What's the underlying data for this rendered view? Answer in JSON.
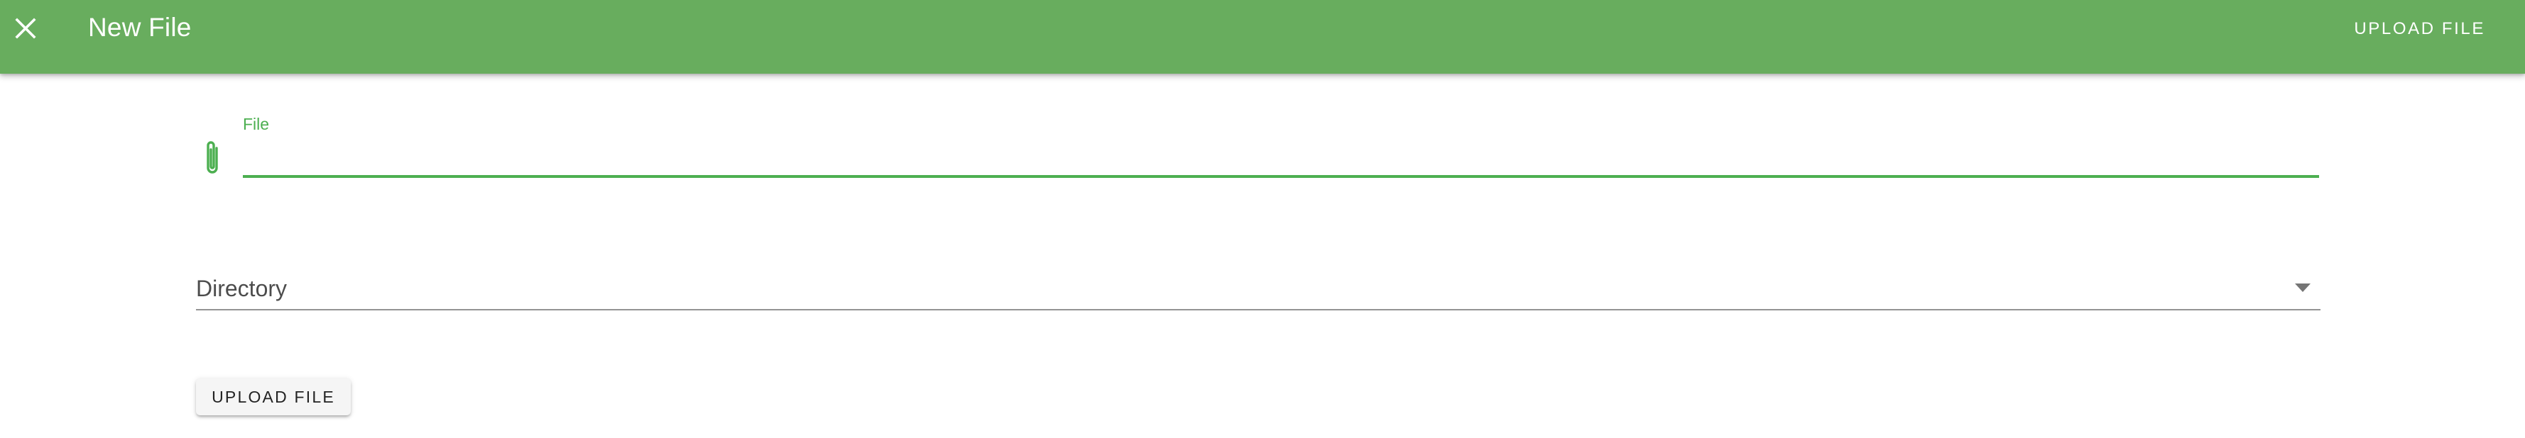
{
  "toolbar": {
    "title": "New File",
    "action_label": "UPLOAD FILE",
    "close_icon": "close-icon",
    "background_color": "#68ad5e"
  },
  "form": {
    "file_field": {
      "label": "File",
      "value": "",
      "icon": "paperclip-icon",
      "accent_color": "#4caf50"
    },
    "directory_select": {
      "selected_value": "Directory",
      "icon": "dropdown-arrow-icon"
    },
    "submit_button_label": "UPLOAD FILE"
  }
}
